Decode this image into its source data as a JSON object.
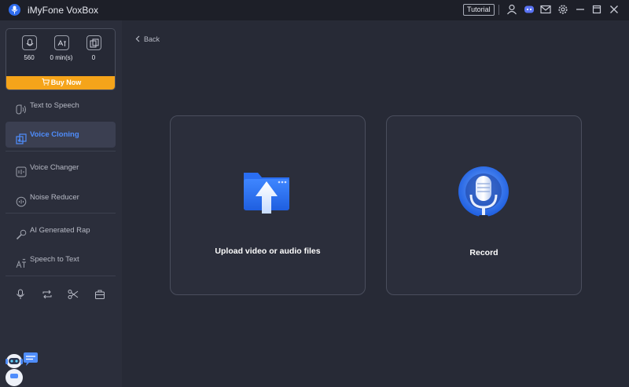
{
  "app": {
    "title": "iMyFone VoxBox"
  },
  "titlebar": {
    "tutorial_label": "Tutorial"
  },
  "stats": [
    {
      "icon": "voice-credits-icon",
      "value": "560"
    },
    {
      "icon": "text-minutes-icon",
      "value": "0 min(s)"
    },
    {
      "icon": "clones-icon",
      "value": "0"
    }
  ],
  "buy": {
    "label": "Buy Now"
  },
  "sidebar": {
    "items": [
      {
        "label": "Text to Speech"
      },
      {
        "label": "Voice Cloning"
      },
      {
        "label": "Voice Changer"
      },
      {
        "label": "Noise Reducer"
      },
      {
        "label": "AI Generated Rap"
      },
      {
        "label": "Speech to Text"
      }
    ]
  },
  "main": {
    "back_label": "Back",
    "upload_label": "Upload video or audio files",
    "record_label": "Record"
  },
  "colors": {
    "accent": "#4f8dfc",
    "buy": "#f5a41a",
    "background": "#272a36",
    "sidebar": "#2b2e3b"
  }
}
